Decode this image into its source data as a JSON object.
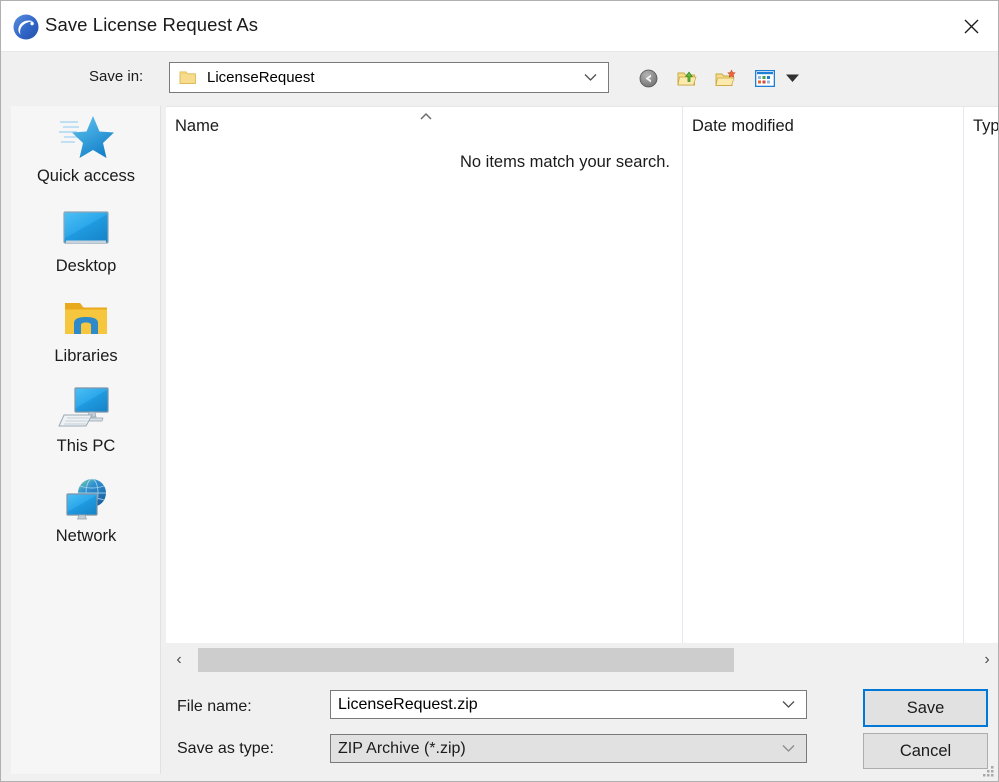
{
  "window": {
    "title": "Save License Request As",
    "app_icon": "app-swoosh-icon",
    "close_label": "✕"
  },
  "savein": {
    "label": "Save in:",
    "value": "LicenseRequest",
    "folder_icon": "folder-icon",
    "chevron_icon": "chevron-down-icon"
  },
  "toolbar": {
    "items": [
      {
        "name": "back-button",
        "icon": "back-arrow-icon",
        "tooltip": "Back"
      },
      {
        "name": "up-one-level-button",
        "icon": "folder-up-arrow-icon",
        "tooltip": "Up One Level"
      },
      {
        "name": "new-folder-button",
        "icon": "new-folder-icon",
        "tooltip": "Create New Folder"
      },
      {
        "name": "views-button",
        "icon": "views-grid-icon",
        "tooltip": "Views"
      },
      {
        "name": "views-dropdown-button",
        "icon": "triangle-down-icon",
        "tooltip": "Views menu"
      }
    ]
  },
  "places": {
    "items": [
      {
        "label": "Quick access",
        "icon": "star-icon"
      },
      {
        "label": "Desktop",
        "icon": "monitor-icon"
      },
      {
        "label": "Libraries",
        "icon": "libraries-folder-icon"
      },
      {
        "label": "This PC",
        "icon": "this-pc-icon"
      },
      {
        "label": "Network",
        "icon": "network-globe-icon"
      }
    ]
  },
  "filelist": {
    "columns": [
      {
        "label": "Name",
        "sorted": "ascending",
        "sort_icon": "caret-up-icon"
      },
      {
        "label": "Date modified",
        "sorted": "none"
      },
      {
        "label": "Typ",
        "sorted": "none"
      }
    ],
    "rows": [],
    "empty_message": "No items match your search."
  },
  "scrollbar": {
    "left_arrow": "‹",
    "right_arrow": "›"
  },
  "form": {
    "filename_label": "File name:",
    "filename_value": "LicenseRequest.zip",
    "filename_placeholder": "File name",
    "savetype_label": "Save as type:",
    "savetype_value": "ZIP Archive (*.zip)",
    "chevron_icon": "chevron-down-icon"
  },
  "buttons": {
    "save_label": "Save",
    "cancel_label": "Cancel"
  },
  "colors": {
    "accent": "#0078d7",
    "dialog_background": "#f0f0f0",
    "titlebar_background": "#ffffff",
    "places_background": "#f6f6f6",
    "list_background": "#ffffff",
    "button_face": "#e1e1e1",
    "scroll_thumb": "#cdcdcd",
    "folder_yellow": "#f5d578",
    "icon_blue": "#2aa3e8"
  }
}
